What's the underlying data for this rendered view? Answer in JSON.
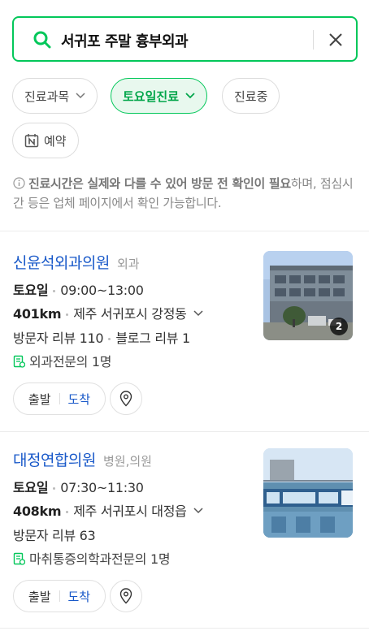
{
  "search": {
    "query": "서귀포 주말 흉부외과"
  },
  "filters": {
    "department": "진료과목",
    "saturday": "토요일진료",
    "open_now": "진료중",
    "reservation": "예약"
  },
  "notice": {
    "bold_part": "진료시간은 실제와 다를 수 있어 방문 전 확인이 필요",
    "rest": "하며, 점심시간 등은 업체 페이지에서 확인 가능합니다."
  },
  "results": [
    {
      "name": "신윤석외과의원",
      "category": "외과",
      "day": "토요일",
      "hours": "09:00~13:00",
      "distance": "401km",
      "address": "제주 서귀포시 강정동",
      "visitor_reviews": "방문자 리뷰 110",
      "blog_reviews": "블로그 리뷰 1",
      "specialist": "외과전문의 1명",
      "depart": "출발",
      "arrive": "도착",
      "photo_count": "2"
    },
    {
      "name": "대정연합의원",
      "category": "병원,의원",
      "day": "토요일",
      "hours": "07:30~11:30",
      "distance": "408km",
      "address": "제주 서귀포시 대정읍",
      "visitor_reviews": "방문자 리뷰 63",
      "specialist": "마취통증의학과전문의 1명",
      "depart": "출발",
      "arrive": "도착"
    }
  ],
  "colors": {
    "accent": "#03c75a",
    "link": "#1959c9"
  }
}
